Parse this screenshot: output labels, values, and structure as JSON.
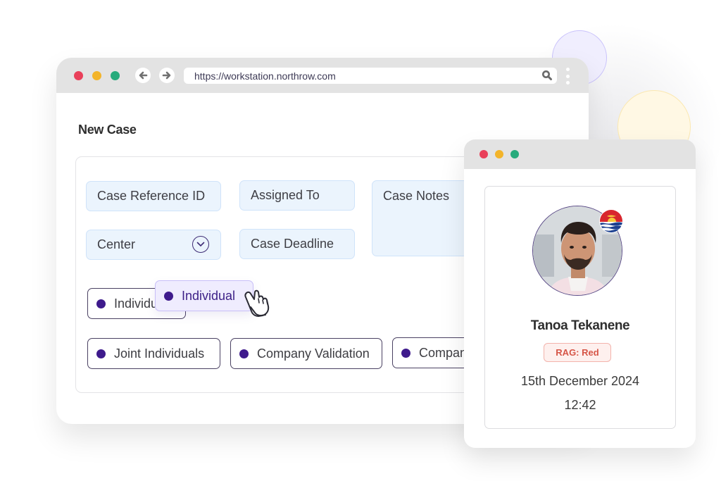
{
  "browser": {
    "url": "https://workstation.northrow.com",
    "icons": [
      "back-arrow-icon",
      "forward-arrow-icon",
      "search-icon",
      "kebab-menu-icon"
    ]
  },
  "page": {
    "title": "New Case"
  },
  "form": {
    "case_reference_placeholder": "Case Reference ID",
    "assigned_to_placeholder": "Assigned To",
    "case_notes_placeholder": "Case Notes",
    "center_label": "Center",
    "case_deadline_placeholder": "Case Deadline"
  },
  "case_types": {
    "options": [
      "Individual",
      "Joint Individuals",
      "Company Validation",
      "Company"
    ],
    "dragging": "Individual"
  },
  "profile": {
    "name": "Tanoa Tekanene",
    "rag_status": "RAG: Red",
    "date": "15th December 2024",
    "time": "12:42",
    "rag_color": "#d65547"
  },
  "colors": {
    "accent": "#3e1a8c",
    "window_red": "#e9405a",
    "window_yellow": "#f3b42a",
    "window_green": "#27ab7c"
  }
}
